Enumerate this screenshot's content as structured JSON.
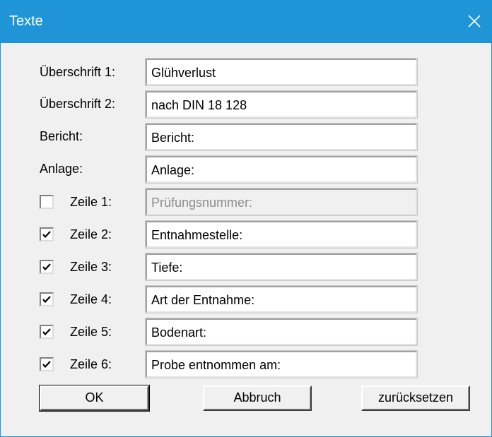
{
  "window": {
    "title": "Texte",
    "close_icon": "close-icon",
    "colors": {
      "titlebar": "#1f94d6",
      "title_text": "#ffffff",
      "body": "#f0f0f0"
    }
  },
  "fields": [
    {
      "label": "Überschrift 1:",
      "value": "Glühverlust"
    },
    {
      "label": "Überschrift 2:",
      "value": "nach DIN 18 128"
    },
    {
      "label": "Bericht:",
      "value": "Bericht:"
    },
    {
      "label": "Anlage:",
      "value": "Anlage:"
    }
  ],
  "lines": [
    {
      "label": "Zeile 1:",
      "value": "Prüfungsnummer:",
      "checked": false
    },
    {
      "label": "Zeile 2:",
      "value": "Entnahmestelle:",
      "checked": true
    },
    {
      "label": "Zeile 3:",
      "value": "Tiefe:",
      "checked": true
    },
    {
      "label": "Zeile 4:",
      "value": "Art der Entnahme:",
      "checked": true
    },
    {
      "label": "Zeile 5:",
      "value": "Bodenart:",
      "checked": true
    },
    {
      "label": "Zeile 6:",
      "value": "Probe entnommen am:",
      "checked": true
    }
  ],
  "buttons": {
    "ok": "OK",
    "cancel": "Abbruch",
    "reset": "zurücksetzen"
  }
}
